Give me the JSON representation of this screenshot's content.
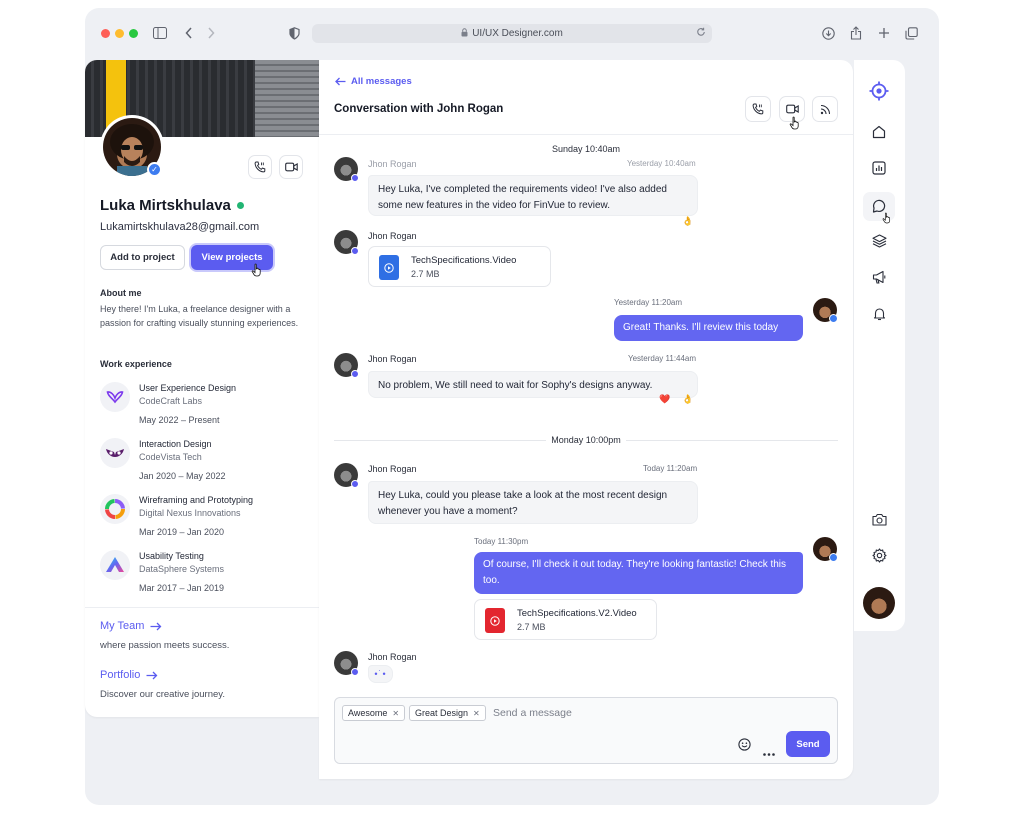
{
  "browser": {
    "address": "UI/UX Designer.com",
    "traffic_colors": [
      "#fe5f57",
      "#febc2e",
      "#28c840"
    ]
  },
  "profile": {
    "name": "Luka Mirtskhulava",
    "email": "Lukamirtskhulava28@gmail.com",
    "add_to_project_label": "Add to project",
    "view_projects_label": "View projects",
    "about_heading": "About me",
    "about_text": "Hey there! I'm Luka, a freelance designer with a passion for crafting visually stunning experiences.",
    "work_heading": "Work experience",
    "jobs": [
      {
        "title": "User Experience Design",
        "company": "CodeCraft Labs",
        "dates": "May 2022 – Present",
        "logo": "butterfly-logo"
      },
      {
        "title": "Interaction Design",
        "company": "CodeVista Tech",
        "dates": "Jan 2020 – May 2022",
        "logo": "owl-logo"
      },
      {
        "title": "Wireframing and Prototyping",
        "company": "Digital Nexus Innovations",
        "dates": "Mar 2019 – Jan 2020",
        "logo": "ring-logo"
      },
      {
        "title": "Usability Testing",
        "company": "DataSphere Systems",
        "dates": "Mar 2017 – Jan 2019",
        "logo": "arrow-logo"
      }
    ],
    "team_link": "My Team",
    "team_desc": "where passion meets success.",
    "portfolio_link": "Portfolio",
    "portfolio_desc": "Discover our creative journey."
  },
  "chat": {
    "back_label": "All messages",
    "title": "Conversation with John Rogan",
    "day1": "Sunday 10:40am",
    "day2": "Monday 10:00pm",
    "messages": [
      {
        "sender": "Jhon Rogan",
        "time": "Yesterday 10:40am",
        "text": "Hey Luka, I've completed the requirements video! I've also added some new features in the video for FinVue to review."
      },
      {
        "sender": "Jhon Rogan",
        "file_name": "TechSpecifications.Video",
        "file_size": "2.7 MB"
      },
      {
        "time": "Yesterday 11:20am",
        "text": "Great! Thanks. I'll review this today"
      },
      {
        "sender": "Jhon Rogan",
        "time": "Yesterday 11:44am",
        "text": "No problem, We still need to wait for Sophy's designs anyway."
      },
      {
        "sender": "Jhon Rogan",
        "time": "Today 11:20am",
        "text": "Hey Luka, could you please take a look at the most recent design whenever you have a moment?"
      },
      {
        "time": "Today 11:30pm",
        "text": "Of course, I'll check it out today. They're looking fantastic! Check this too.",
        "file_name": "TechSpecifications.V2.Video",
        "file_size": "2.7 MB"
      },
      {
        "sender": "Jhon Rogan",
        "typing": "•˙•"
      }
    ],
    "reactions": {
      "ok": "👌",
      "heart": "❤️"
    },
    "composer": {
      "tags": [
        "Awesome",
        "Great Design"
      ],
      "placeholder": "Send a message",
      "send_label": "Send"
    }
  },
  "colors": {
    "accent": "#5b5cf0",
    "online": "#22b573",
    "verified": "#3d7cf0",
    "file_blue": "#2f6fe4",
    "file_red": "#e3262f"
  }
}
